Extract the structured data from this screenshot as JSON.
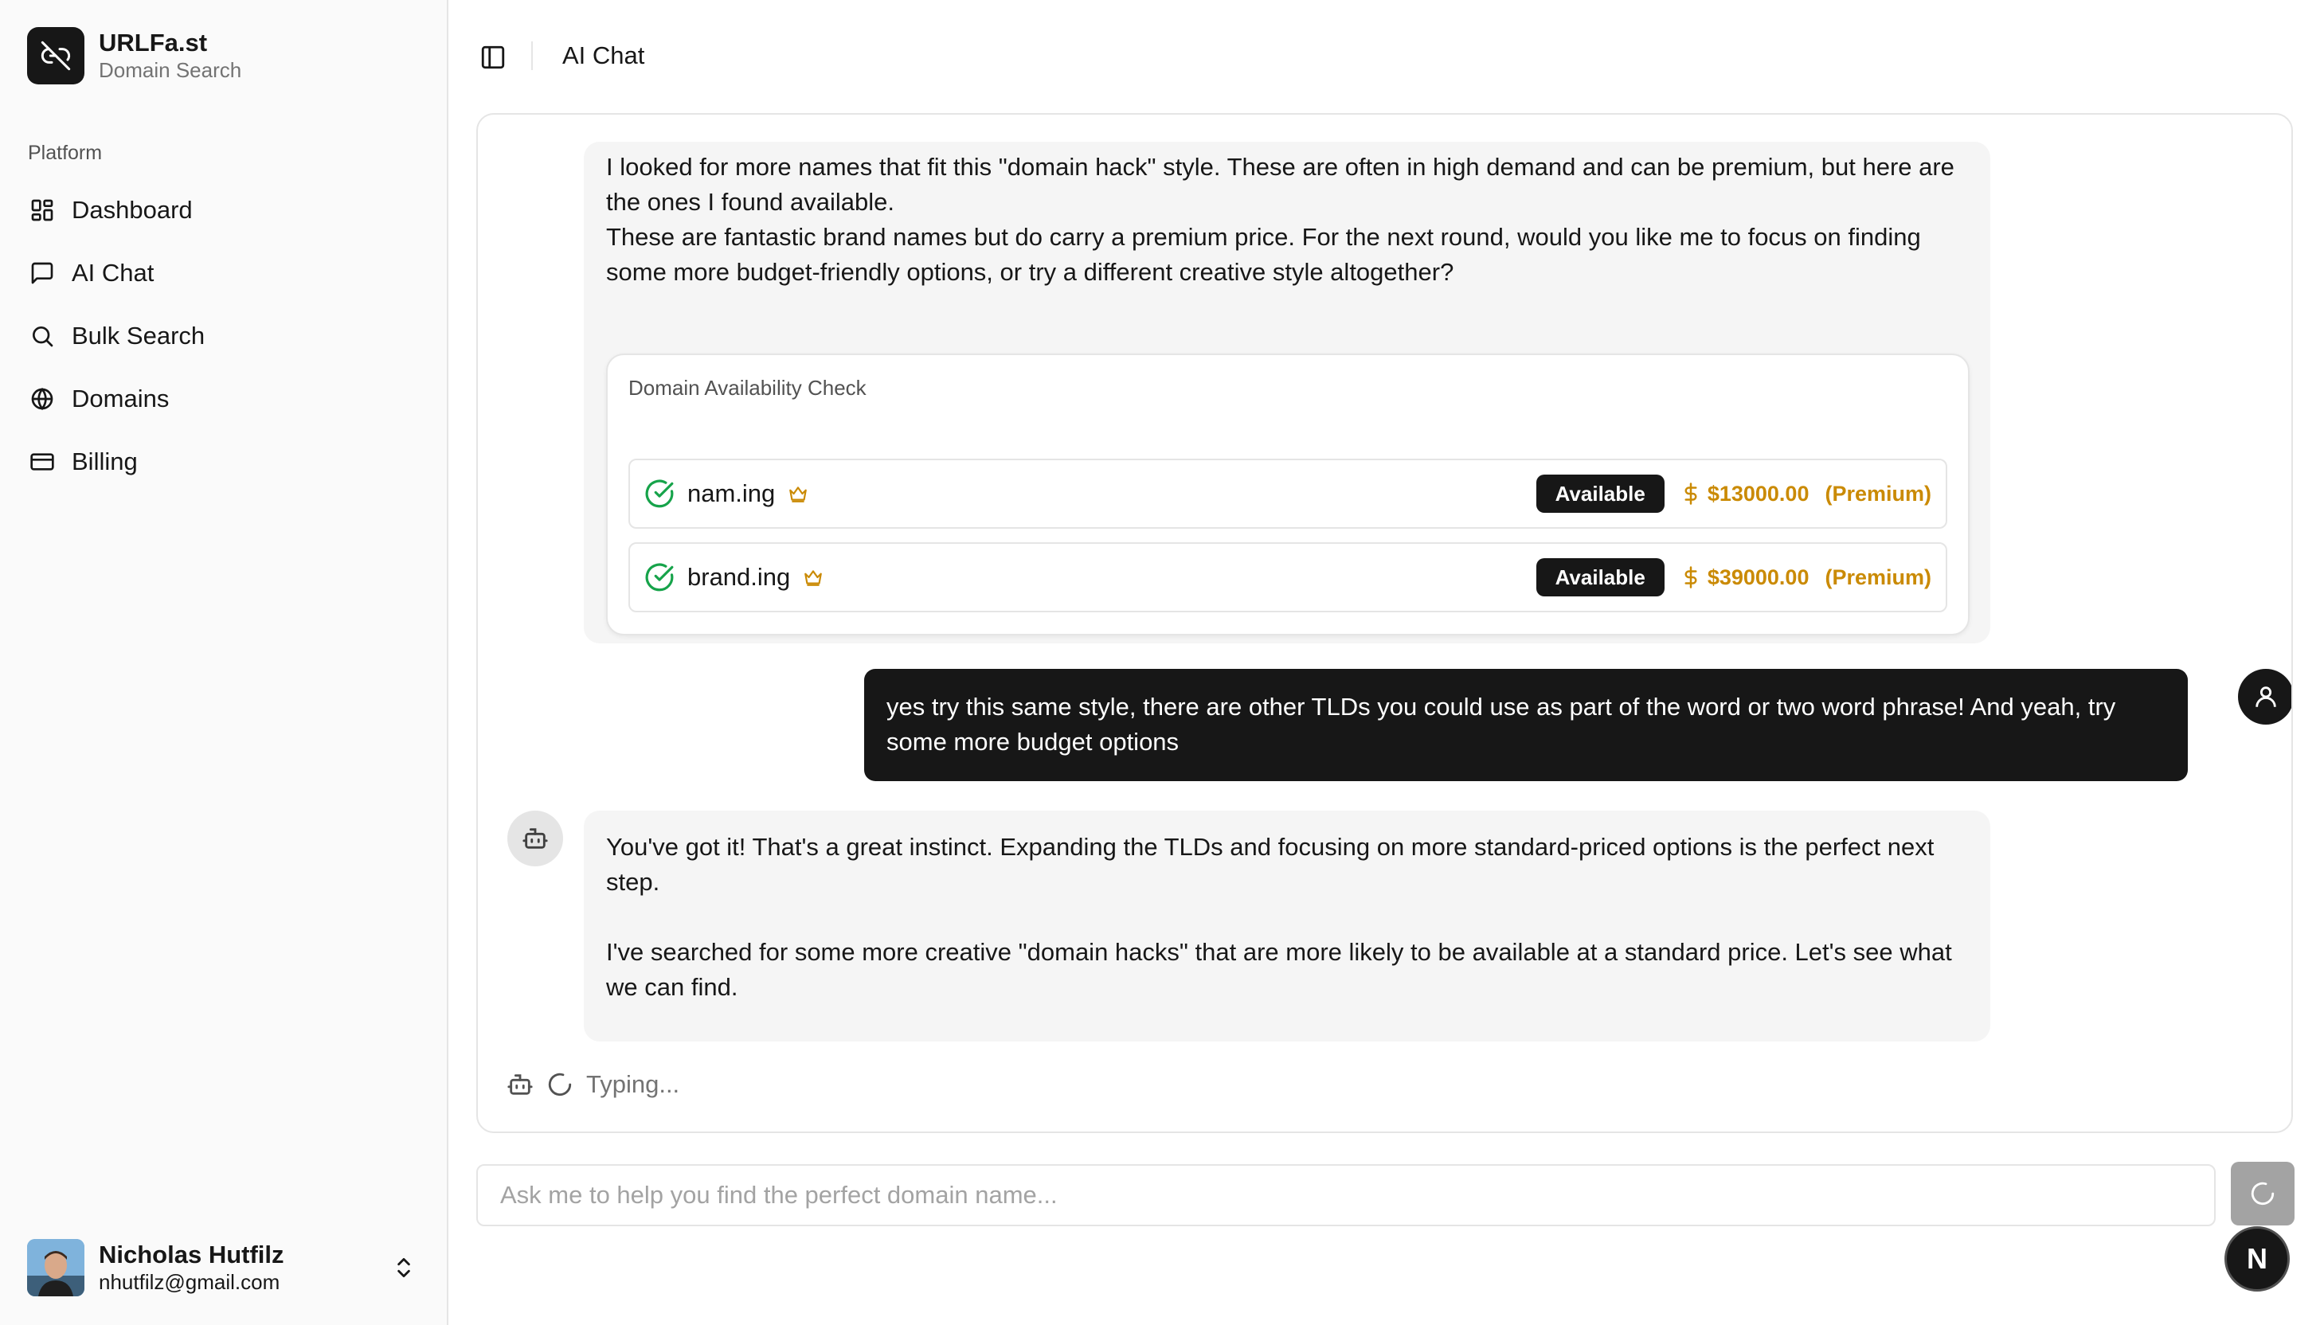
{
  "brand": {
    "name": "URLFa.st",
    "subtitle": "Domain Search",
    "logo_icon": "link-icon"
  },
  "sidebar": {
    "group_label": "Platform",
    "items": [
      {
        "label": "Dashboard",
        "icon": "dashboard-icon"
      },
      {
        "label": "AI Chat",
        "icon": "message-icon"
      },
      {
        "label": "Bulk Search",
        "icon": "search-icon"
      },
      {
        "label": "Domains",
        "icon": "globe-icon"
      },
      {
        "label": "Billing",
        "icon": "credit-card-icon"
      }
    ]
  },
  "user": {
    "name": "Nicholas Hutfilz",
    "email": "nhutfilz@gmail.com"
  },
  "header": {
    "title": "AI Chat"
  },
  "chat": {
    "messages": [
      {
        "role": "assistant",
        "paragraphs": [
          "I looked for more names that fit this \"domain hack\" style. These are often in high demand and can be premium, but here are the ones I found available.",
          "These are fantastic brand names but do carry a premium price. For the next round, would you like me to focus on finding some more budget-friendly options, or try a different creative style altogether?"
        ],
        "domain_check": {
          "title": "Domain Availability Check",
          "results": [
            {
              "domain": "nam.ing",
              "status": "Available",
              "price": "$13000.00",
              "tier": "(Premium)"
            },
            {
              "domain": "brand.ing",
              "status": "Available",
              "price": "$39000.00",
              "tier": "(Premium)"
            }
          ]
        }
      },
      {
        "role": "user",
        "text": "yes try this same style, there are other TLDs you could use as part of the word or two word phrase! And yeah, try some more budget options"
      },
      {
        "role": "assistant",
        "paragraphs": [
          "You've got it! That's a great instinct. Expanding the TLDs and focusing on more standard-priced options is the perfect next step.",
          "I've searched for some more creative \"domain hacks\" that are more likely to be available at a standard price. Let's see what we can find."
        ]
      }
    ],
    "typing_text": "Typing..."
  },
  "composer": {
    "placeholder": "Ask me to help you find the perfect domain name...",
    "value": ""
  },
  "badge": {
    "letter": "N"
  },
  "colors": {
    "primary": "#171717",
    "premium": "#ca8a04",
    "success": "#16a34a",
    "muted": "#737373"
  }
}
